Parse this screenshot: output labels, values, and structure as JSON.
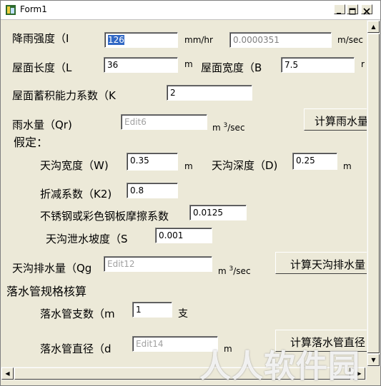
{
  "window": {
    "title": "Form1"
  },
  "titlebar_buttons": {
    "minimize": "_",
    "maximize": "□",
    "close": "✕"
  },
  "form": {
    "rain_intensity": {
      "label": "降雨强度（I",
      "value": "126",
      "unit": "mm/hr"
    },
    "rain_intensity_converted": {
      "value": "0.0000351",
      "unit": "m/sec"
    },
    "roof_length": {
      "label": "屋面长度（L",
      "value": "36",
      "unit": "m"
    },
    "roof_width": {
      "label": "屋面宽度（B",
      "value": "7.5",
      "unit": "r"
    },
    "storage_coeff": {
      "label": "屋面蓄积能力系数（K",
      "value": "2"
    },
    "rain_volume": {
      "label": "雨水量（Qr)",
      "value": "Edit6",
      "unit_pre": "m",
      "unit_sup": "3",
      "unit_post": "/sec",
      "button": "计算雨水量"
    },
    "assumption_header": "假定：",
    "gutter_width": {
      "label": "天沟宽度（W)",
      "value": "0.35",
      "unit": "m"
    },
    "gutter_depth": {
      "label": "天沟深度（D)",
      "value": "0.25",
      "unit": "m"
    },
    "reduction_coeff": {
      "label": "折减系数（K2)",
      "value": "0.8"
    },
    "friction_coeff": {
      "label": "不锈钢或彩色钢板摩擦系数",
      "value": "0.0125"
    },
    "gutter_slope": {
      "label": "天沟泄水坡度（S",
      "value": "0.001"
    },
    "gutter_discharge": {
      "label": "天沟排水量（Qg",
      "value": "Edit12",
      "unit_pre": "m",
      "unit_sup": "3",
      "unit_post": "/sec",
      "button": "计算天沟排水量"
    },
    "downpipe_header": "落水管规格核算",
    "downpipe_count": {
      "label": "落水管支数（m",
      "value": "1",
      "unit": "支"
    },
    "downpipe_diameter": {
      "label": "落水管直径（d",
      "value": "Edit14",
      "unit": "m",
      "button": "计算落水管直径"
    }
  },
  "watermark": "人人软件园",
  "scrollbars": {
    "up": "▲",
    "down": "▼",
    "left": "◀",
    "right": "▶"
  }
}
